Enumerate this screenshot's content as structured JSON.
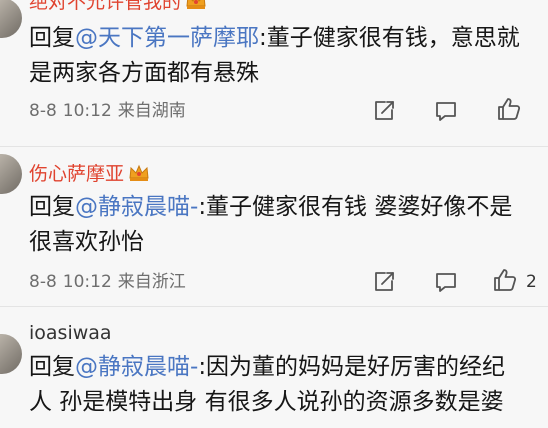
{
  "comments": [
    {
      "username": "绝对不允许管我的",
      "reply_prefix": "回复",
      "mention": "@天下第一萨摩耶",
      "text_line1": ":董子健家很有钱，意思就",
      "text_line2": "是两家各方面都有悬殊",
      "date": "8-8",
      "time": "10:12",
      "location": "来自湖南",
      "likes": ""
    },
    {
      "username": "伤心萨摩亚",
      "reply_prefix": "回复",
      "mention": "@静寂晨喵-",
      "text_line1": ":董子健家很有钱  婆婆好像不是",
      "text_line2": "很喜欢孙怡",
      "date": "8-8",
      "time": "10:12",
      "location": "来自浙江",
      "likes": "2"
    },
    {
      "username": "ioasiwaa",
      "reply_prefix": "回复",
      "mention": "@静寂晨喵-",
      "text_line1": ":因为董的妈妈是好厉害的经纪",
      "text_line2": "人  孙是模特出身  有很多人说孙的资源多数是婆",
      "date": "",
      "time": "",
      "location": "",
      "likes": ""
    }
  ],
  "colors": {
    "mention": "#4a76c2",
    "username_vip": "#e0432f",
    "username_normal": "#333333",
    "meta": "#6e6e6e",
    "crown": "#f0a020"
  },
  "icons": [
    "repost-icon",
    "comment-icon",
    "like-icon",
    "vip-crown-icon"
  ]
}
